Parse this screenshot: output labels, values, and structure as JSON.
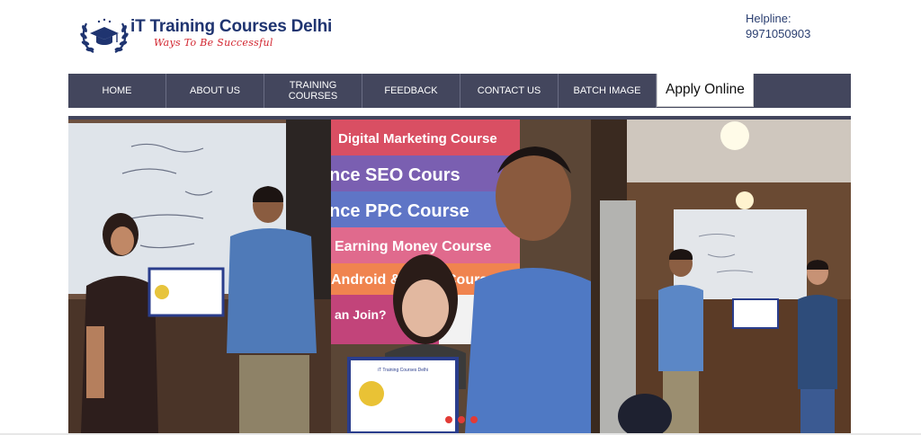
{
  "brand": {
    "title": "iT Training Courses Delhi",
    "tagline": "Ways To Be Successful",
    "colors": {
      "title": "#1f3470",
      "tagline": "#d2252f"
    }
  },
  "helpline": {
    "label": "Helpline:",
    "number": "9971050903"
  },
  "nav": {
    "items": [
      {
        "label": "HOME"
      },
      {
        "label": "ABOUT US"
      },
      {
        "label": "TRAINING COURSES"
      },
      {
        "label": "FEEDBACK"
      },
      {
        "label": "CONTACT US"
      },
      {
        "label": "BATCH IMAGE"
      }
    ],
    "apply_label": "Apply Online",
    "colors": {
      "bar": "#43465d"
    }
  },
  "slider": {
    "banner_lines": [
      "Digital Marketing Course",
      "nce SEO Cours",
      "nce PPC Course",
      "Earning Money Course",
      "Android & O",
      "Course",
      "an Join?"
    ],
    "certificate_heading": "iT Training Courses Delhi",
    "dots_count": 3,
    "dot_color": "#e23b36"
  }
}
